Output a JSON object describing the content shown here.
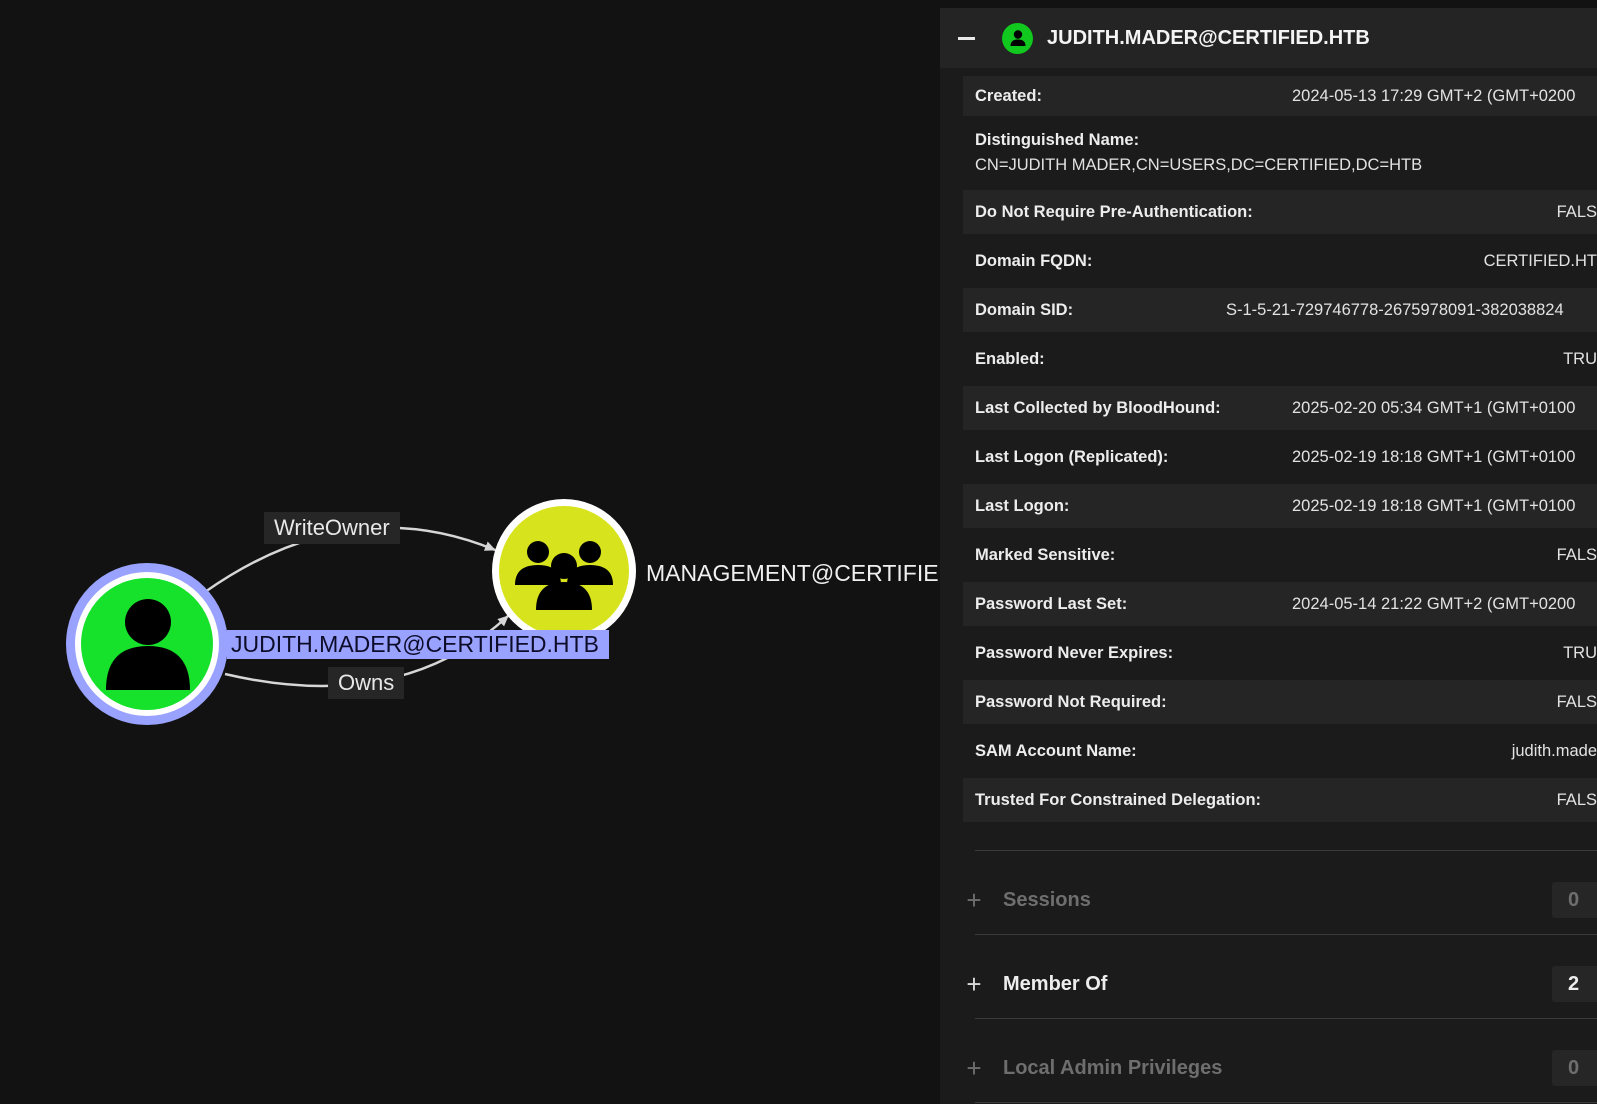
{
  "graph": {
    "nodes": [
      {
        "id": "user",
        "label": "JUDITH.MADER@CERTIFIED.HTB",
        "type": "user",
        "selected": true,
        "color": "#16e12b",
        "ring_color": "#9aa2ff",
        "icon": "user-icon"
      },
      {
        "id": "group",
        "label": "MANAGEMENT@CERTIFIE",
        "type": "group",
        "selected": false,
        "color": "#d7e31c",
        "ring_color": "#ffffff",
        "icon": "group-icon"
      }
    ],
    "edges": [
      {
        "label": "WriteOwner",
        "from": "user",
        "to": "group"
      },
      {
        "label": "Owns",
        "from": "user",
        "to": "group"
      }
    ]
  },
  "panel": {
    "title": "JUDITH.MADER@CERTIFIED.HTB",
    "collapse_icon": "minus-icon",
    "badge_icon": "user-icon",
    "badge_color": "#10c81e",
    "properties": [
      {
        "key": "Created:",
        "value": "2024-05-13 17:29 GMT+2 (GMT+0200"
      },
      {
        "key": "Distinguished Name:",
        "value": "CN=JUDITH MADER,CN=USERS,DC=CERTIFIED,DC=HTB"
      },
      {
        "key": "Do Not Require Pre-Authentication:",
        "value": "FALS"
      },
      {
        "key": "Domain FQDN:",
        "value": "CERTIFIED.HT"
      },
      {
        "key": "Domain SID:",
        "value": "S-1-5-21-729746778-2675978091-382038824"
      },
      {
        "key": "Enabled:",
        "value": "TRU"
      },
      {
        "key": "Last Collected by BloodHound:",
        "value": "2025-02-20 05:34 GMT+1 (GMT+0100"
      },
      {
        "key": "Last Logon (Replicated):",
        "value": "2025-02-19 18:18 GMT+1 (GMT+0100"
      },
      {
        "key": "Last Logon:",
        "value": "2025-02-19 18:18 GMT+1 (GMT+0100"
      },
      {
        "key": "Marked Sensitive:",
        "value": "FALS"
      },
      {
        "key": "Password Last Set:",
        "value": "2024-05-14 21:22 GMT+2 (GMT+0200"
      },
      {
        "key": "Password Never Expires:",
        "value": "TRU"
      },
      {
        "key": "Password Not Required:",
        "value": "FALS"
      },
      {
        "key": "SAM Account Name:",
        "value": "judith.made"
      },
      {
        "key": "Trusted For Constrained Delegation:",
        "value": "FALS"
      }
    ],
    "sections": [
      {
        "title": "Sessions",
        "count": "0",
        "enabled": false,
        "icon": "plus-icon"
      },
      {
        "title": "Member Of",
        "count": "2",
        "enabled": true,
        "icon": "plus-icon"
      },
      {
        "title": "Local Admin Privileges",
        "count": "0",
        "enabled": false,
        "icon": "plus-icon"
      }
    ]
  }
}
